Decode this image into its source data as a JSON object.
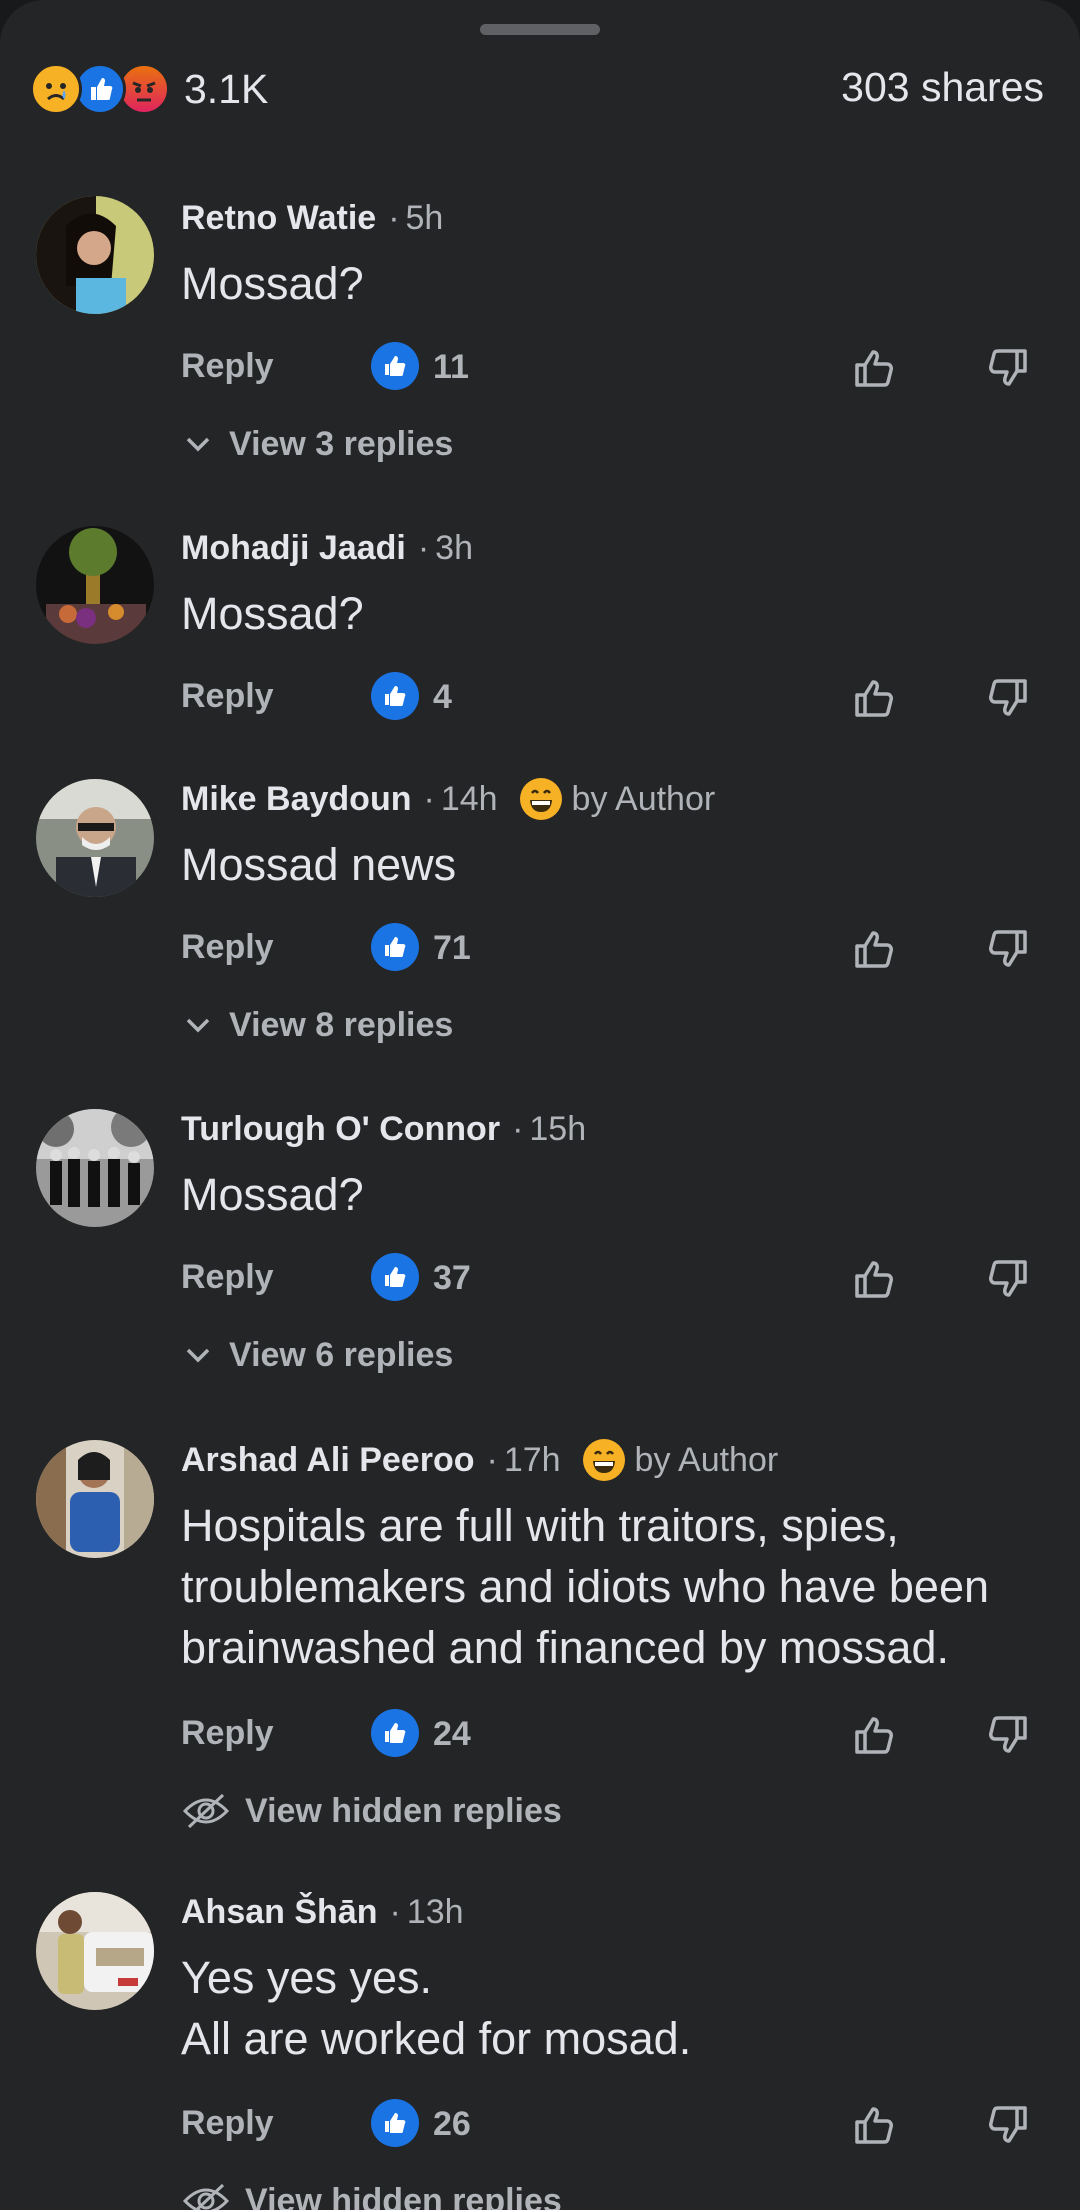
{
  "header": {
    "reaction_count": "3.1K",
    "shares": "303 shares",
    "reaction_icons": [
      "sad-reaction",
      "like-reaction",
      "angry-reaction"
    ]
  },
  "comments": [
    {
      "name": "Retno Watie",
      "time": "5h",
      "author_badge": "",
      "text": "Mossad?",
      "reply_label": "Reply",
      "likes": "11",
      "view_replies": "View 3 replies"
    },
    {
      "name": "Mohadji Jaadi",
      "time": "3h",
      "author_badge": "",
      "text": "Mossad?",
      "reply_label": "Reply",
      "likes": "4",
      "view_replies": ""
    },
    {
      "name": "Mike Baydoun",
      "time": "14h",
      "author_badge": "by Author",
      "text": "Mossad news",
      "reply_label": "Reply",
      "likes": "71",
      "view_replies": "View 8 replies"
    },
    {
      "name": "Turlough O' Connor",
      "time": "15h",
      "author_badge": "",
      "text": "Mossad?",
      "reply_label": "Reply",
      "likes": "37",
      "view_replies": "View 6 replies"
    },
    {
      "name": "Arshad Ali Peeroo",
      "time": "17h",
      "author_badge": "by Author",
      "text": "Hospitals are full with traitors, spies, troublemakers and idiots who have been brainwashed and financed by mossad.",
      "reply_label": "Reply",
      "likes": "24",
      "view_replies": "View hidden replies"
    },
    {
      "name": "Ahsan Šhān",
      "time": "13h",
      "author_badge": "",
      "text": "Yes yes yes.\nAll are worked for mosad.",
      "reply_label": "Reply",
      "likes": "26",
      "view_replies": "View hidden replies"
    }
  ],
  "colors": {
    "background": "#242526",
    "primary_text": "#e4e6eb",
    "secondary_text": "#b0b3b8",
    "like_blue": "#1b74e4"
  }
}
